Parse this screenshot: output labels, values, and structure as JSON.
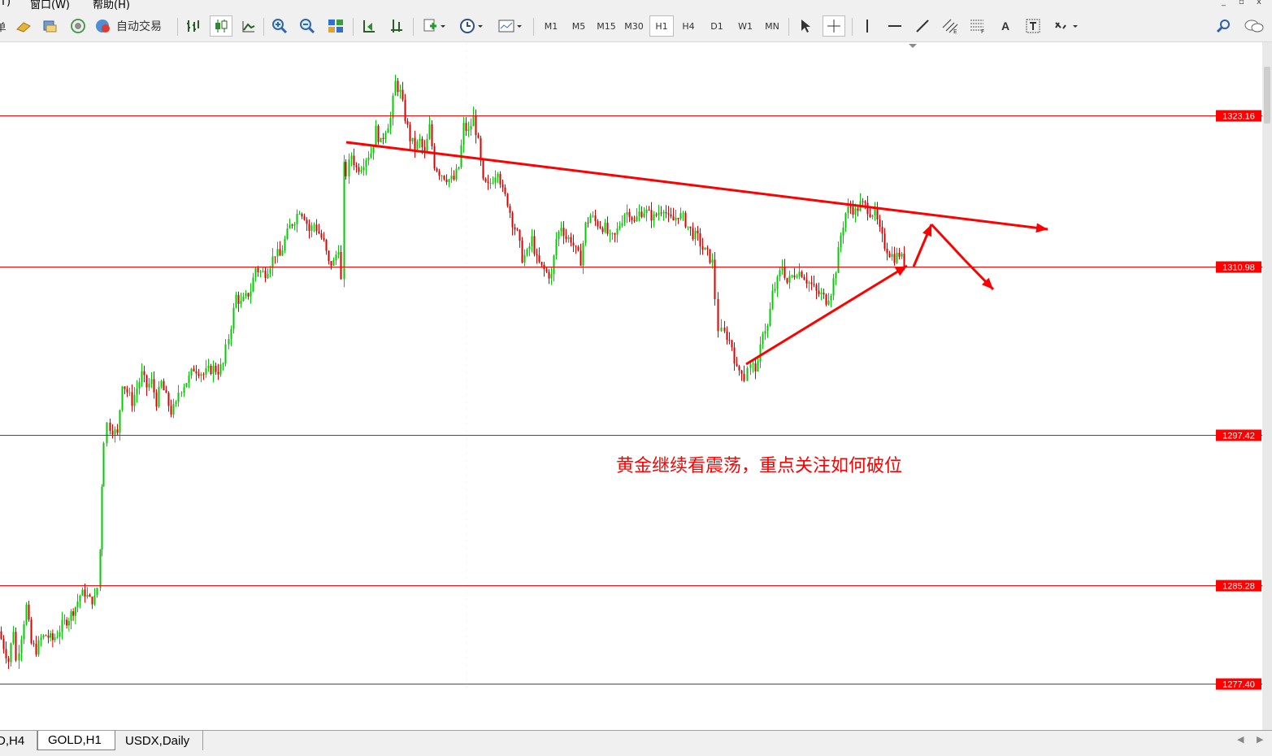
{
  "menu": {
    "items": [
      "T)",
      "窗口(W)",
      "帮助(H)"
    ]
  },
  "window_controls": [
    "_",
    "▫",
    "x"
  ],
  "toolbar": {
    "auto_trade_label": "自动交易",
    "timeframes": [
      "M1",
      "M5",
      "M15",
      "M30",
      "H1",
      "H4",
      "D1",
      "W1",
      "MN"
    ],
    "active_timeframe": "H1",
    "text_tool": "A"
  },
  "chart": {
    "annotation": "黄金继续看震荡，重点关注如何破位",
    "price_levels": [
      "1323.16",
      "1310.98",
      "1297.42",
      "1285.28",
      "1277.40"
    ],
    "level_color": "#ff0000",
    "bull_color": "#00cc00",
    "bear_color": "#dd0000",
    "arrow_color": "#ff0000"
  },
  "tabs": {
    "items": [
      "D,H4",
      "GOLD,H1",
      "USDX,Daily"
    ],
    "active": "GOLD,H1"
  },
  "chart_data": {
    "type": "candlestick",
    "symbol": "GOLD",
    "timeframe": "H1",
    "ylim": [
      1276,
      1335
    ],
    "horizontal_levels": [
      1323.16,
      1310.98,
      1297.42,
      1285.28,
      1277.4
    ],
    "annotation": "黄金继续看震荡，重点关注如何破位",
    "close_path": [
      [
        0,
        1281.6
      ],
      [
        6,
        1280.4
      ],
      [
        12,
        1279.2
      ],
      [
        18,
        1281.8
      ],
      [
        22,
        1279.2
      ],
      [
        28,
        1281.3
      ],
      [
        34,
        1283.6
      ],
      [
        40,
        1280.6
      ],
      [
        46,
        1280.1
      ],
      [
        52,
        1281.0
      ],
      [
        58,
        1281.3
      ],
      [
        66,
        1280.9
      ],
      [
        72,
        1281.4
      ],
      [
        78,
        1282.1
      ],
      [
        86,
        1282.7
      ],
      [
        94,
        1283.6
      ],
      [
        100,
        1284.5
      ],
      [
        106,
        1284.7
      ],
      [
        112,
        1284.1
      ],
      [
        118,
        1284.2
      ],
      [
        122,
        1285.1
      ],
      [
        124,
        1288.2
      ],
      [
        126,
        1293.5
      ],
      [
        130,
        1297.1
      ],
      [
        134,
        1298.3
      ],
      [
        140,
        1297.9
      ],
      [
        146,
        1297.4
      ],
      [
        152,
        1301.7
      ],
      [
        158,
        1300.9
      ],
      [
        164,
        1300.1
      ],
      [
        170,
        1301.2
      ],
      [
        176,
        1302.3
      ],
      [
        182,
        1301.3
      ],
      [
        188,
        1301.7
      ],
      [
        194,
        1300.1
      ],
      [
        200,
        1301.6
      ],
      [
        206,
        1300.4
      ],
      [
        212,
        1299.3
      ],
      [
        218,
        1299.8
      ],
      [
        222,
        1300.9
      ],
      [
        228,
        1301.5
      ],
      [
        234,
        1302.0
      ],
      [
        240,
        1302.8
      ],
      [
        246,
        1302.6
      ],
      [
        252,
        1302.3
      ],
      [
        258,
        1302.6
      ],
      [
        264,
        1302.8
      ],
      [
        270,
        1302.6
      ],
      [
        276,
        1303.1
      ],
      [
        280,
        1304.3
      ],
      [
        286,
        1306.3
      ],
      [
        292,
        1308.6
      ],
      [
        298,
        1308.0
      ],
      [
        304,
        1308.5
      ],
      [
        310,
        1309.1
      ],
      [
        316,
        1310.9
      ],
      [
        322,
        1310.5
      ],
      [
        328,
        1310.5
      ],
      [
        334,
        1311.2
      ],
      [
        340,
        1312.1
      ],
      [
        346,
        1311.8
      ],
      [
        352,
        1313.1
      ],
      [
        358,
        1314.2
      ],
      [
        364,
        1314.8
      ],
      [
        370,
        1315.6
      ],
      [
        376,
        1315.1
      ],
      [
        382,
        1313.9
      ],
      [
        388,
        1314.4
      ],
      [
        394,
        1313.7
      ],
      [
        400,
        1312.9
      ],
      [
        406,
        1311.2
      ],
      [
        412,
        1311.3
      ],
      [
        418,
        1312.6
      ],
      [
        422,
        1309.8
      ],
      [
        424,
        1319.0
      ],
      [
        428,
        1318.5
      ],
      [
        434,
        1320.0
      ],
      [
        440,
        1318.9
      ],
      [
        446,
        1319.1
      ],
      [
        452,
        1319.8
      ],
      [
        458,
        1320.2
      ],
      [
        464,
        1322.0
      ],
      [
        470,
        1320.9
      ],
      [
        476,
        1322.1
      ],
      [
        482,
        1322.9
      ],
      [
        488,
        1325.8
      ],
      [
        494,
        1325.0
      ],
      [
        500,
        1323.0
      ],
      [
        506,
        1321.3
      ],
      [
        512,
        1320.6
      ],
      [
        518,
        1321.1
      ],
      [
        524,
        1320.0
      ],
      [
        530,
        1322.2
      ],
      [
        536,
        1319.2
      ],
      [
        542,
        1318.6
      ],
      [
        548,
        1318.3
      ],
      [
        554,
        1318.0
      ],
      [
        560,
        1318.0
      ],
      [
        566,
        1319.0
      ],
      [
        572,
        1322.3
      ],
      [
        578,
        1321.8
      ],
      [
        584,
        1323.0
      ],
      [
        590,
        1320.9
      ],
      [
        596,
        1317.7
      ],
      [
        602,
        1317.4
      ],
      [
        608,
        1318.1
      ],
      [
        614,
        1318.9
      ],
      [
        620,
        1317.0
      ],
      [
        626,
        1316.2
      ],
      [
        632,
        1314.6
      ],
      [
        638,
        1313.6
      ],
      [
        644,
        1311.7
      ],
      [
        650,
        1312.0
      ],
      [
        656,
        1313.2
      ],
      [
        662,
        1311.5
      ],
      [
        668,
        1310.9
      ],
      [
        674,
        1310.5
      ],
      [
        680,
        1310.2
      ],
      [
        686,
        1313.2
      ],
      [
        692,
        1314.3
      ],
      [
        698,
        1313.3
      ],
      [
        704,
        1313.2
      ],
      [
        710,
        1312.2
      ],
      [
        716,
        1311.5
      ],
      [
        722,
        1314.3
      ],
      [
        728,
        1315.1
      ],
      [
        734,
        1314.6
      ],
      [
        740,
        1314.3
      ],
      [
        746,
        1314.1
      ],
      [
        752,
        1313.2
      ],
      [
        758,
        1313.4
      ],
      [
        764,
        1314.4
      ],
      [
        770,
        1315.3
      ],
      [
        776,
        1315.4
      ],
      [
        782,
        1314.5
      ],
      [
        788,
        1315.3
      ],
      [
        794,
        1315.5
      ],
      [
        800,
        1315.2
      ],
      [
        806,
        1314.9
      ],
      [
        812,
        1315.4
      ],
      [
        818,
        1315.8
      ],
      [
        824,
        1314.8
      ],
      [
        830,
        1314.7
      ],
      [
        836,
        1315.2
      ],
      [
        842,
        1314.9
      ],
      [
        848,
        1314.2
      ],
      [
        854,
        1313.6
      ],
      [
        860,
        1313.3
      ],
      [
        866,
        1312.4
      ],
      [
        872,
        1312.0
      ],
      [
        878,
        1311.3
      ],
      [
        882,
        1308.5
      ],
      [
        886,
        1306.0
      ],
      [
        890,
        1305.7
      ],
      [
        896,
        1305.4
      ],
      [
        902,
        1304.6
      ],
      [
        908,
        1302.6
      ],
      [
        914,
        1302.7
      ],
      [
        918,
        1302.0
      ],
      [
        922,
        1303.0
      ],
      [
        928,
        1302.9
      ],
      [
        934,
        1302.9
      ],
      [
        940,
        1305.9
      ],
      [
        946,
        1306.1
      ],
      [
        952,
        1308.8
      ],
      [
        958,
        1309.8
      ],
      [
        964,
        1311.1
      ],
      [
        970,
        1309.7
      ],
      [
        976,
        1310.2
      ],
      [
        982,
        1310.6
      ],
      [
        988,
        1310.5
      ],
      [
        994,
        1309.9
      ],
      [
        1000,
        1309.5
      ],
      [
        1006,
        1308.9
      ],
      [
        1012,
        1308.7
      ],
      [
        1018,
        1308.3
      ],
      [
        1024,
        1309.0
      ],
      [
        1030,
        1310.8
      ],
      [
        1036,
        1313.5
      ],
      [
        1042,
        1315.3
      ],
      [
        1048,
        1315.8
      ],
      [
        1054,
        1315.4
      ],
      [
        1060,
        1316.0
      ],
      [
        1066,
        1315.9
      ],
      [
        1072,
        1315.4
      ],
      [
        1078,
        1315.3
      ],
      [
        1084,
        1313.8
      ],
      [
        1090,
        1312.7
      ],
      [
        1096,
        1312.1
      ],
      [
        1102,
        1311.7
      ],
      [
        1108,
        1312.0
      ],
      [
        1114,
        1311.3
      ]
    ]
  }
}
